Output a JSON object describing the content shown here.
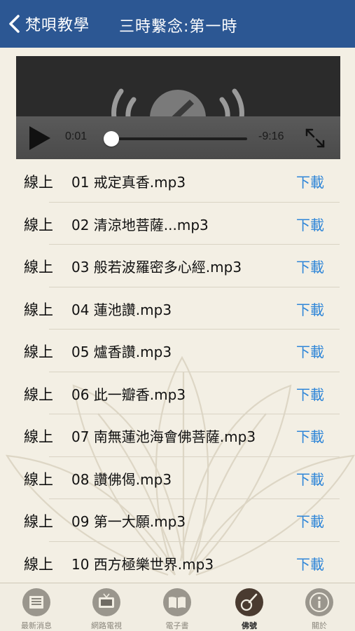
{
  "navbar": {
    "back_label": "梵唄教學",
    "title": "三時繫念:第一時"
  },
  "player": {
    "current_time": "0:01",
    "remaining_time": "-9:16",
    "progress": 0.002
  },
  "tracks": [
    {
      "tag": "線上",
      "name": "01 戒定真香.mp3",
      "action": "下載"
    },
    {
      "tag": "線上",
      "name": "02 清涼地菩薩...mp3",
      "action": "下載"
    },
    {
      "tag": "線上",
      "name": "03 般若波羅密多心經.mp3",
      "action": "下載"
    },
    {
      "tag": "線上",
      "name": "04 蓮池讚.mp3",
      "action": "下載"
    },
    {
      "tag": "線上",
      "name": "05 爐香讚.mp3",
      "action": "下載"
    },
    {
      "tag": "線上",
      "name": "06 此一瓣香.mp3",
      "action": "下載"
    },
    {
      "tag": "線上",
      "name": "07 南無蓮池海會佛菩薩.mp3",
      "action": "下載"
    },
    {
      "tag": "線上",
      "name": "08 讚佛偈.mp3",
      "action": "下載"
    },
    {
      "tag": "線上",
      "name": "09 第一大願.mp3",
      "action": "下載"
    },
    {
      "tag": "線上",
      "name": "10 西方極樂世界.mp3",
      "action": "下載"
    }
  ],
  "tabs": [
    {
      "label": "最新消息",
      "icon": "newspaper-icon"
    },
    {
      "label": "網路電視",
      "icon": "tv-icon"
    },
    {
      "label": "電子書",
      "icon": "book-icon"
    },
    {
      "label": "佛號",
      "icon": "music-icon",
      "active": true
    },
    {
      "label": "關於",
      "icon": "info-icon"
    }
  ],
  "colors": {
    "navbar": "#2c5793",
    "background": "#f3efe4",
    "link": "#2f86d8"
  }
}
